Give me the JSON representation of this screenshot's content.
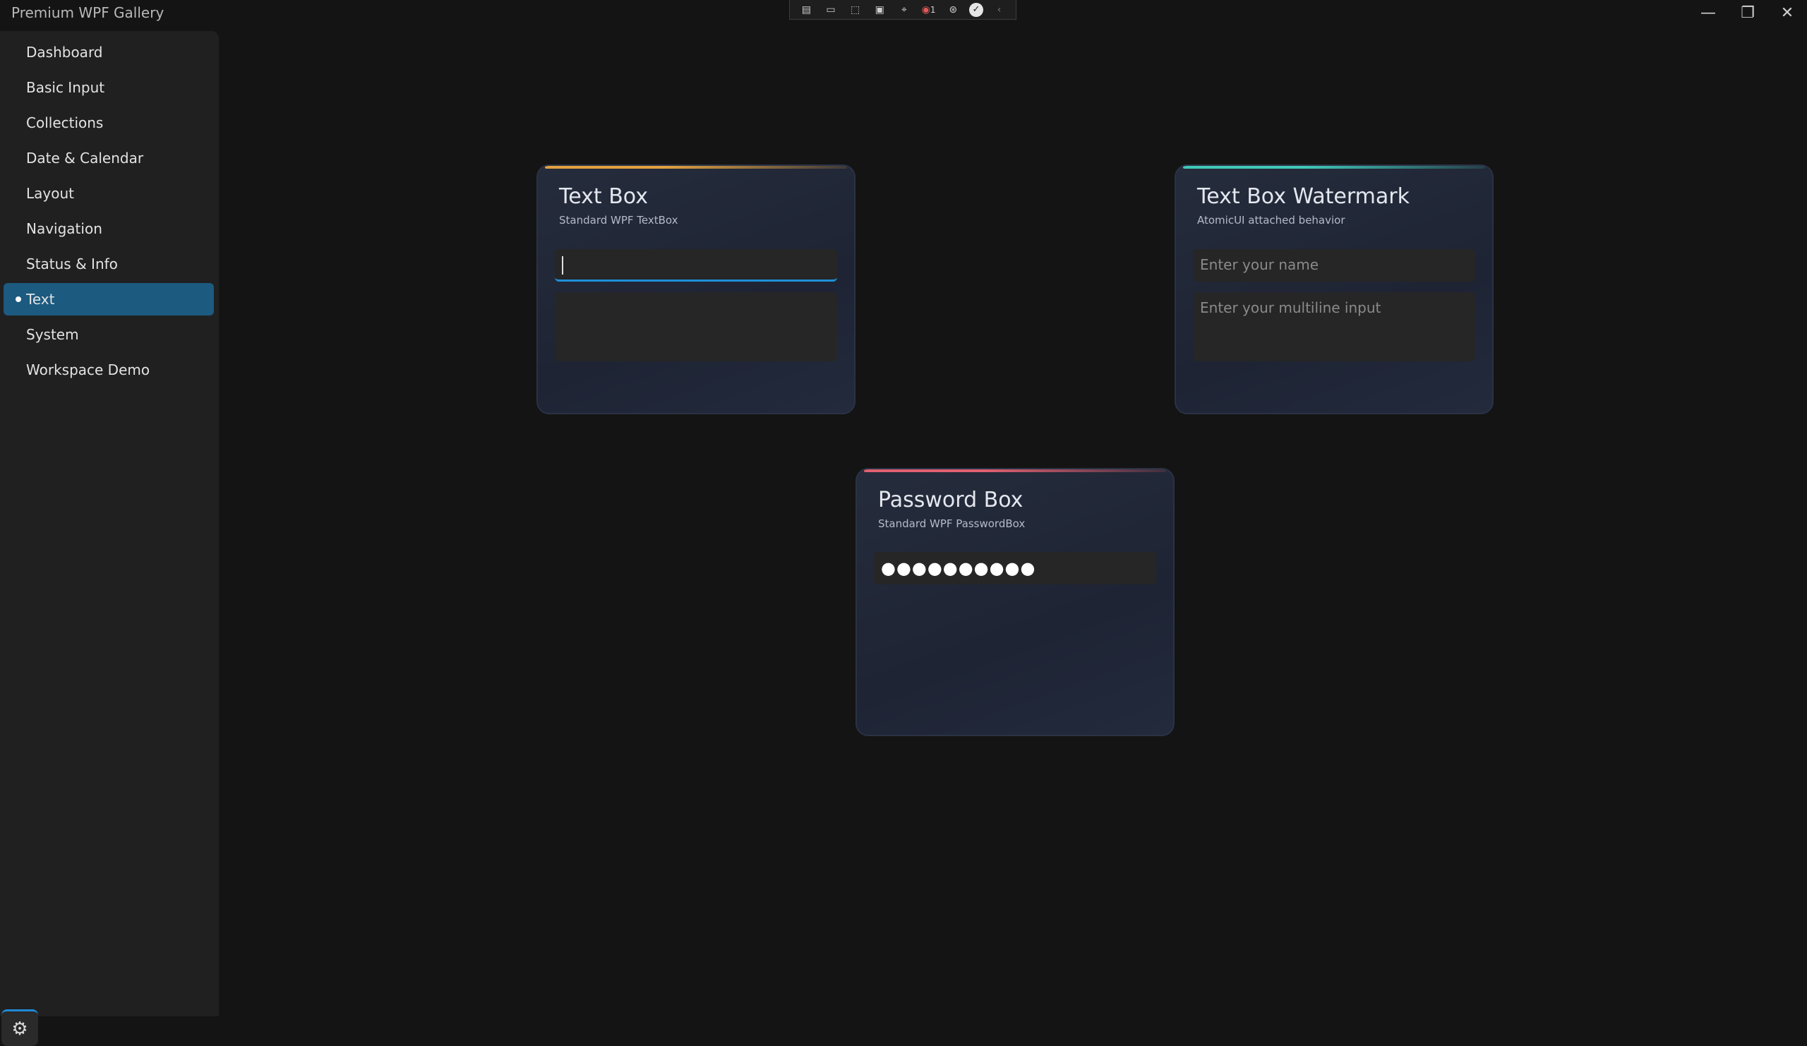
{
  "window": {
    "title": "Premium WPF Gallery",
    "minimize": "—",
    "restore": "❐",
    "close": "✕"
  },
  "debug_toolbar": {
    "badge_count": "1"
  },
  "sidebar": {
    "items": [
      {
        "label": "Dashboard"
      },
      {
        "label": "Basic Input"
      },
      {
        "label": "Collections"
      },
      {
        "label": "Date & Calendar"
      },
      {
        "label": "Layout"
      },
      {
        "label": "Navigation"
      },
      {
        "label": "Status & Info"
      },
      {
        "label": "Text",
        "active": true
      },
      {
        "label": "System"
      },
      {
        "label": "Workspace Demo"
      }
    ]
  },
  "cards": {
    "textbox": {
      "title": "Text Box",
      "subtitle": "Standard WPF TextBox",
      "accent": "#e0a040"
    },
    "watermark": {
      "title": "Text Box Watermark",
      "subtitle": "AtomicUI attached behavior",
      "single_placeholder": "Enter your name",
      "multi_placeholder": "Enter your multiline input",
      "accent": "#40c8b8"
    },
    "password": {
      "title": "Password Box",
      "subtitle": "Standard WPF PasswordBox",
      "value": "●●●●●●●●●●",
      "accent": "#e06070"
    }
  },
  "colors": {
    "background": "#141414",
    "sidebar": "#202020",
    "active_nav": "#1c5a80",
    "focus": "#1e90d8"
  }
}
